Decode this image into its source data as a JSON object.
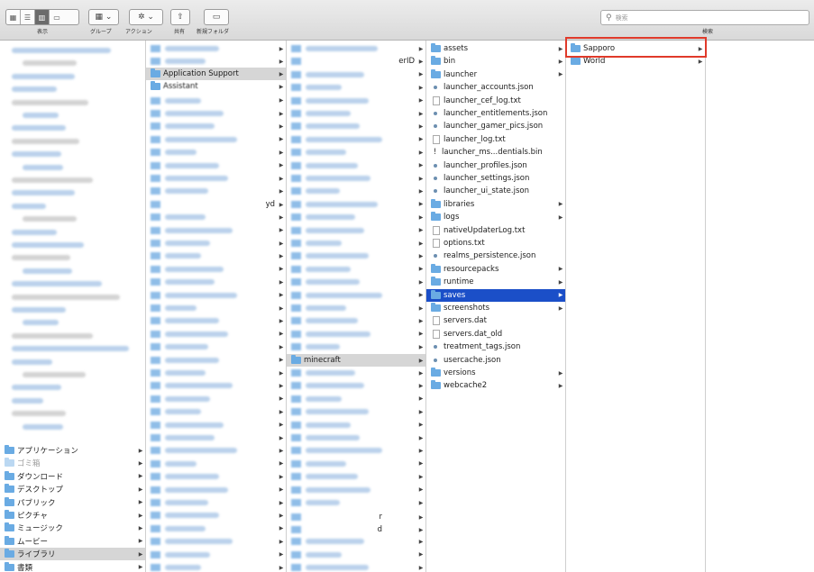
{
  "toolbar": {
    "labels": {
      "view": "表示",
      "group": "グループ",
      "action": "アクション",
      "share": "共有",
      "new_folder": "新規フォルダ"
    },
    "search_placeholder": "検索",
    "search_scope_label": "検索"
  },
  "column1": {
    "items": [
      {
        "label": "アプリケーション",
        "type": "folder"
      },
      {
        "label": "ゴミ箱",
        "type": "folder-faded"
      },
      {
        "label": "ダウンロード",
        "type": "folder"
      },
      {
        "label": "デスクトップ",
        "type": "folder"
      },
      {
        "label": "パブリック",
        "type": "folder"
      },
      {
        "label": "ピクチャ",
        "type": "folder"
      },
      {
        "label": "ミュージック",
        "type": "folder"
      },
      {
        "label": "ムービー",
        "type": "folder"
      },
      {
        "label": "ライブラリ",
        "type": "folder",
        "state": "highlighted"
      },
      {
        "label": "書類",
        "type": "folder"
      }
    ]
  },
  "column2": {
    "selected_label": "Application Support",
    "next_label": "Assistant"
  },
  "column3": {
    "partial_label_a": "erID",
    "selected_label": "minecraft"
  },
  "column2_partial": {
    "label": "yd"
  },
  "column3_partial": {
    "label_r": "r",
    "label_d": "d"
  },
  "column4": {
    "items": [
      {
        "label": "assets",
        "type": "folder",
        "arrow": true
      },
      {
        "label": "bin",
        "type": "folder",
        "arrow": true
      },
      {
        "label": "launcher",
        "type": "folder",
        "arrow": true
      },
      {
        "label": "launcher_accounts.json",
        "type": "dot"
      },
      {
        "label": "launcher_cef_log.txt",
        "type": "doc"
      },
      {
        "label": "launcher_entitlements.json",
        "type": "dot"
      },
      {
        "label": "launcher_gamer_pics.json",
        "type": "dot"
      },
      {
        "label": "launcher_log.txt",
        "type": "doc"
      },
      {
        "label": "launcher_ms...dentials.bin",
        "type": "excl"
      },
      {
        "label": "launcher_profiles.json",
        "type": "dot"
      },
      {
        "label": "launcher_settings.json",
        "type": "dot"
      },
      {
        "label": "launcher_ui_state.json",
        "type": "dot"
      },
      {
        "label": "libraries",
        "type": "folder",
        "arrow": true
      },
      {
        "label": "logs",
        "type": "folder",
        "arrow": true
      },
      {
        "label": "nativeUpdaterLog.txt",
        "type": "doc"
      },
      {
        "label": "options.txt",
        "type": "doc"
      },
      {
        "label": "realms_persistence.json",
        "type": "dot"
      },
      {
        "label": "resourcepacks",
        "type": "folder",
        "arrow": true
      },
      {
        "label": "runtime",
        "type": "folder",
        "arrow": true
      },
      {
        "label": "saves",
        "type": "folder",
        "arrow": true,
        "state": "selected"
      },
      {
        "label": "screenshots",
        "type": "folder",
        "arrow": true
      },
      {
        "label": "servers.dat",
        "type": "doc"
      },
      {
        "label": "servers.dat_old",
        "type": "doc"
      },
      {
        "label": "treatment_tags.json",
        "type": "dot"
      },
      {
        "label": "usercache.json",
        "type": "dot"
      },
      {
        "label": "versions",
        "type": "folder",
        "arrow": true
      },
      {
        "label": "webcache2",
        "type": "folder",
        "arrow": true
      }
    ]
  },
  "column5": {
    "items": [
      {
        "label": "Sapporo",
        "type": "folder",
        "arrow": true,
        "state": "outlined"
      },
      {
        "label": "World",
        "type": "folder",
        "arrow": true
      }
    ]
  },
  "colors": {
    "selection": "#1b4fc8",
    "highlight": "#d6d6d6",
    "folder": "#6aabe3",
    "callout": "#e03a2a"
  }
}
